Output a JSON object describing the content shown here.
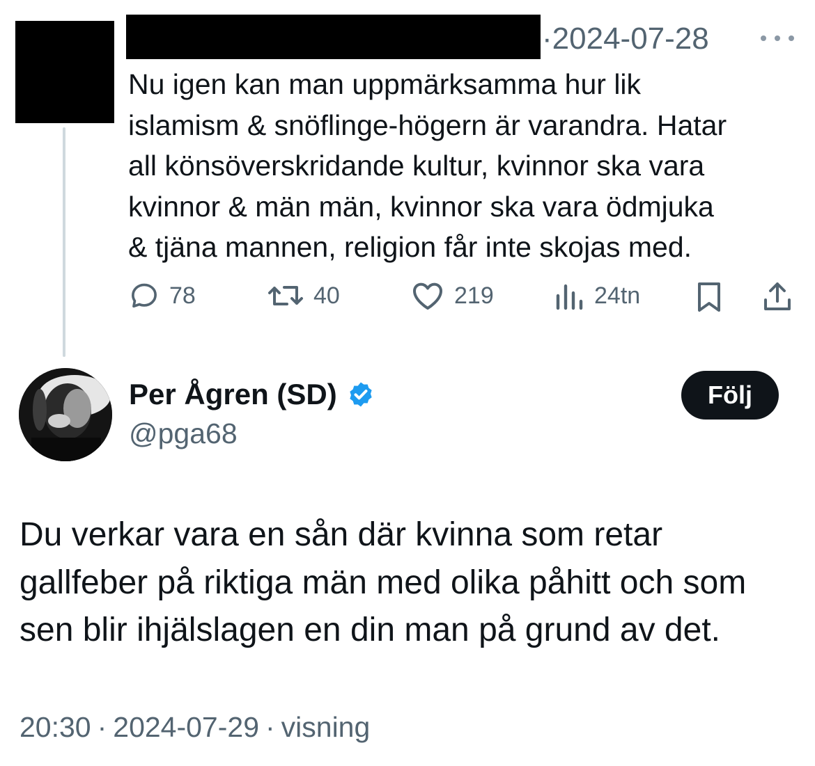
{
  "parent_tweet": {
    "date": "2024-07-28",
    "text": "Nu igen kan man uppmärksamma hur lik\nislamism & snöflinge-högern är varandra. Hatar\nall könsöverskridande kultur, kvinnor ska vara\nkvinnor & män män, kvinnor ska vara ödmjuka\n& tjäna mannen, religion får inte skojas med.",
    "actions": {
      "replies": "78",
      "retweets": "40",
      "likes": "219",
      "views": "24tn"
    }
  },
  "reply_tweet": {
    "display_name": "Per Ågren (SD)",
    "handle": "@pga68",
    "follow_label": "Följ",
    "text": "Du verkar vara en sån där kvinna som retar\ngallfeber på riktiga män med olika påhitt och som\nsen blir ihjälslagen en din man på grund av det.",
    "time": "20:30",
    "date": "2024-07-29",
    "views_label": "visning"
  },
  "colors": {
    "text": "#0f1419",
    "secondary": "#536471",
    "verified": "#1d9bf0",
    "thread_line": "#cfd9de"
  }
}
